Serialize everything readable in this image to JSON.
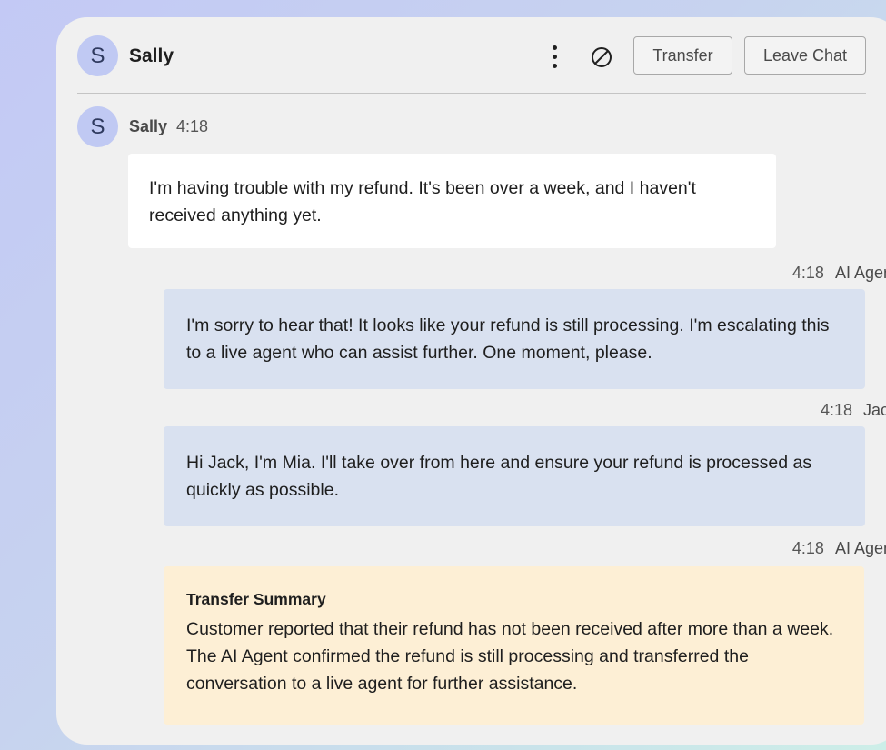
{
  "header": {
    "avatar_initial": "S",
    "name": "Sally",
    "transfer_label": "Transfer",
    "leave_label": "Leave Chat"
  },
  "messages": [
    {
      "sender": "Sally",
      "avatar_initial": "S",
      "time": "4:18",
      "text": "I'm having trouble with my refund. It's been over a week, and I haven't received anything yet."
    },
    {
      "sender": "AI Agent",
      "time": "4:18",
      "text": "I'm sorry to hear that! It looks like your refund is still processing. I'm escalating this to a live agent who can assist further. One moment, please."
    },
    {
      "sender": "Jack",
      "time": "4:18",
      "text": "Hi Jack, I'm Mia. I'll take over from here and ensure your refund is processed as quickly as possible."
    },
    {
      "sender": "AI Agent",
      "time": "4:18",
      "summary_title": "Transfer Summary",
      "text": "Customer reported that their refund has not been received after more than a week. The AI Agent confirmed the refund is still processing and transferred the conversation to a live agent for further assistance."
    }
  ],
  "icons": {
    "menu": "more-vertical-icon",
    "block": "block-icon"
  },
  "colors": {
    "avatar_bg": "#c0c9f3",
    "agent_bubble": "#d9e1f0",
    "summary_bubble": "#fdefd5",
    "panel_bg": "#f0f0f0"
  }
}
